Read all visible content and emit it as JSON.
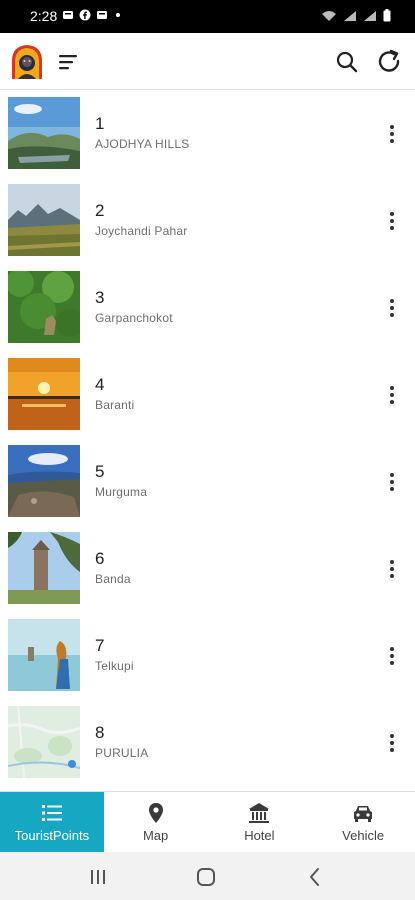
{
  "status_bar": {
    "time": "2:28",
    "left_icons": [
      "notification-icon",
      "facebook-icon",
      "notification-icon"
    ],
    "right_icons": [
      "wifi-icon",
      "signal-icon",
      "signal-icon",
      "battery-icon"
    ]
  },
  "app_bar": {
    "logo": "app-logo",
    "menu_icon": "menu-icon",
    "search_icon": "search-icon",
    "refresh_icon": "refresh-icon"
  },
  "places": [
    {
      "number": "1",
      "name": "AJODHYA HILLS"
    },
    {
      "number": "2",
      "name": "Joychandi Pahar"
    },
    {
      "number": "3",
      "name": "Garpanchokot"
    },
    {
      "number": "4",
      "name": "Baranti"
    },
    {
      "number": "5",
      "name": "Murguma"
    },
    {
      "number": "6",
      "name": "Banda"
    },
    {
      "number": "7",
      "name": "Telkupi"
    },
    {
      "number": "8",
      "name": "PURULIA"
    }
  ],
  "bottom_nav": [
    {
      "label": "TouristPoints",
      "icon": "list-icon",
      "active": true
    },
    {
      "label": "Map",
      "icon": "map-pin-icon",
      "active": false
    },
    {
      "label": "Hotel",
      "icon": "building-icon",
      "active": false
    },
    {
      "label": "Vehicle",
      "icon": "car-icon",
      "active": false
    }
  ],
  "colors": {
    "accent": "#16a8c2",
    "status_bar": "#000000"
  }
}
